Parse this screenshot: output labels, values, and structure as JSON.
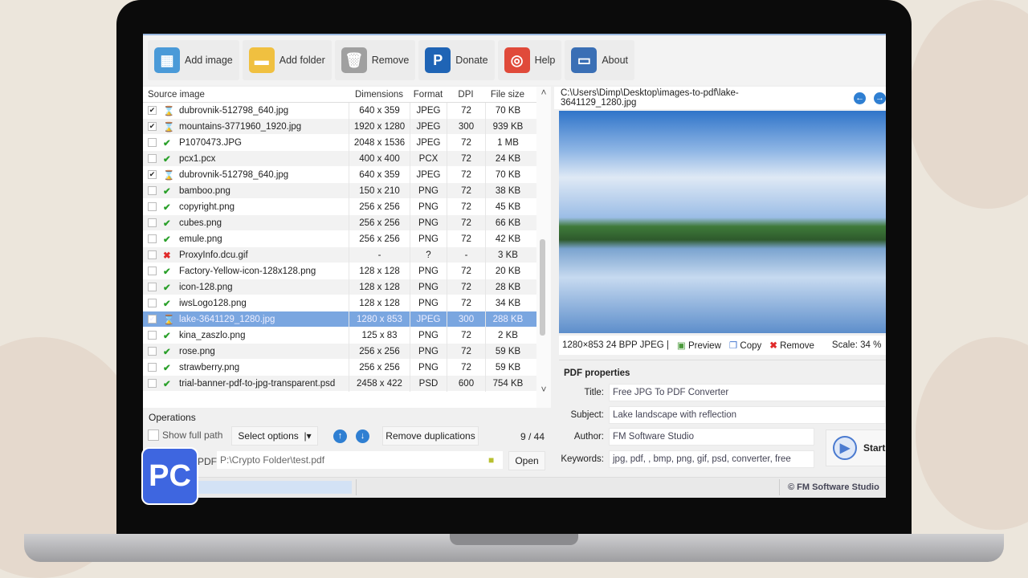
{
  "toolbar": [
    {
      "label": "Add image",
      "icon": "add-image-icon",
      "color": "#4a9ad8"
    },
    {
      "label": "Add folder",
      "icon": "folder-icon",
      "color": "#f0c040"
    },
    {
      "label": "Remove",
      "icon": "trash-icon",
      "color": "#a0a0a0"
    },
    {
      "label": "Donate",
      "icon": "paypal-icon",
      "color": "#1f64b5"
    },
    {
      "label": "Help",
      "icon": "lifebuoy-icon",
      "color": "#e04a3a"
    },
    {
      "label": "About",
      "icon": "monitor-icon",
      "color": "#3a6fb5"
    }
  ],
  "table": {
    "headers": [
      "Source image",
      "Dimensions",
      "Format",
      "DPI",
      "File size"
    ],
    "rows": [
      {
        "checked": true,
        "status": "pending",
        "name": "dubrovnik-512798_640.jpg",
        "dim": "640 x 359",
        "fmt": "JPEG",
        "dpi": "72",
        "size": "70 KB"
      },
      {
        "checked": true,
        "status": "pending",
        "name": "mountains-3771960_1920.jpg",
        "dim": "1920 x 1280",
        "fmt": "JPEG",
        "dpi": "300",
        "size": "939 KB"
      },
      {
        "checked": false,
        "status": "ok",
        "name": "P1070473.JPG",
        "dim": "2048 x 1536",
        "fmt": "JPEG",
        "dpi": "72",
        "size": "1 MB"
      },
      {
        "checked": false,
        "status": "ok",
        "name": "pcx1.pcx",
        "dim": "400 x 400",
        "fmt": "PCX",
        "dpi": "72",
        "size": "24 KB"
      },
      {
        "checked": true,
        "status": "pending",
        "name": "dubrovnik-512798_640.jpg",
        "dim": "640 x 359",
        "fmt": "JPEG",
        "dpi": "72",
        "size": "70 KB"
      },
      {
        "checked": false,
        "status": "ok",
        "name": "bamboo.png",
        "dim": "150 x 210",
        "fmt": "PNG",
        "dpi": "72",
        "size": "38 KB"
      },
      {
        "checked": false,
        "status": "ok",
        "name": "copyright.png",
        "dim": "256 x 256",
        "fmt": "PNG",
        "dpi": "72",
        "size": "45 KB"
      },
      {
        "checked": false,
        "status": "ok",
        "name": "cubes.png",
        "dim": "256 x 256",
        "fmt": "PNG",
        "dpi": "72",
        "size": "66 KB"
      },
      {
        "checked": false,
        "status": "ok",
        "name": "emule.png",
        "dim": "256 x 256",
        "fmt": "PNG",
        "dpi": "72",
        "size": "42 KB"
      },
      {
        "checked": false,
        "status": "error",
        "name": "ProxyInfo.dcu.gif",
        "dim": "-",
        "fmt": "?",
        "dpi": "-",
        "size": "3 KB"
      },
      {
        "checked": false,
        "status": "ok",
        "name": "Factory-Yellow-icon-128x128.png",
        "dim": "128 x 128",
        "fmt": "PNG",
        "dpi": "72",
        "size": "20 KB"
      },
      {
        "checked": false,
        "status": "ok",
        "name": "icon-128.png",
        "dim": "128 x 128",
        "fmt": "PNG",
        "dpi": "72",
        "size": "28 KB"
      },
      {
        "checked": false,
        "status": "ok",
        "name": "iwsLogo128.png",
        "dim": "128 x 128",
        "fmt": "PNG",
        "dpi": "72",
        "size": "34 KB"
      },
      {
        "checked": true,
        "status": "pending",
        "selected": true,
        "name": "lake-3641129_1280.jpg",
        "dim": "1280 x 853",
        "fmt": "JPEG",
        "dpi": "300",
        "size": "288 KB"
      },
      {
        "checked": false,
        "status": "ok",
        "name": "kina_zaszlo.png",
        "dim": "125 x 83",
        "fmt": "PNG",
        "dpi": "72",
        "size": "2 KB"
      },
      {
        "checked": false,
        "status": "ok",
        "name": "rose.png",
        "dim": "256 x 256",
        "fmt": "PNG",
        "dpi": "72",
        "size": "59 KB"
      },
      {
        "checked": false,
        "status": "ok",
        "name": "strawberry.png",
        "dim": "256 x 256",
        "fmt": "PNG",
        "dpi": "72",
        "size": "59 KB"
      },
      {
        "checked": false,
        "status": "ok",
        "name": "trial-banner-pdf-to-jpg-transparent.psd",
        "dim": "2458 x 422",
        "fmt": "PSD",
        "dpi": "600",
        "size": "754 KB"
      }
    ]
  },
  "operations": {
    "title": "Operations",
    "show_full_path": "Show full path",
    "select_options": "Select options",
    "remove_dup": "Remove duplications",
    "count": "9 / 44",
    "pdf_label": "PDF:",
    "pdf_path": "P:\\Crypto Folder\\test.pdf",
    "open": "Open"
  },
  "preview": {
    "path": "C:\\Users\\Dimp\\Desktop\\images-to-pdf\\lake-3641129_1280.jpg",
    "info": "1280×853  24 BPP  JPEG  |",
    "preview": "Preview",
    "copy": "Copy",
    "remove": "Remove",
    "scale": "Scale: 34 %"
  },
  "pdf": {
    "title": "PDF properties",
    "title_label": "Title:",
    "title_value": "Free JPG To PDF Converter",
    "subject_label": "Subject:",
    "subject_value": "Lake landscape with reflection",
    "author_label": "Author:",
    "author_value": "FM Software Studio",
    "keywords_label": "Keywords:",
    "keywords_value": "jpg, pdf, , bmp, png, gif, psd, converter, free",
    "start": "Start"
  },
  "status": {
    "copyright": "© FM Software Studio"
  }
}
